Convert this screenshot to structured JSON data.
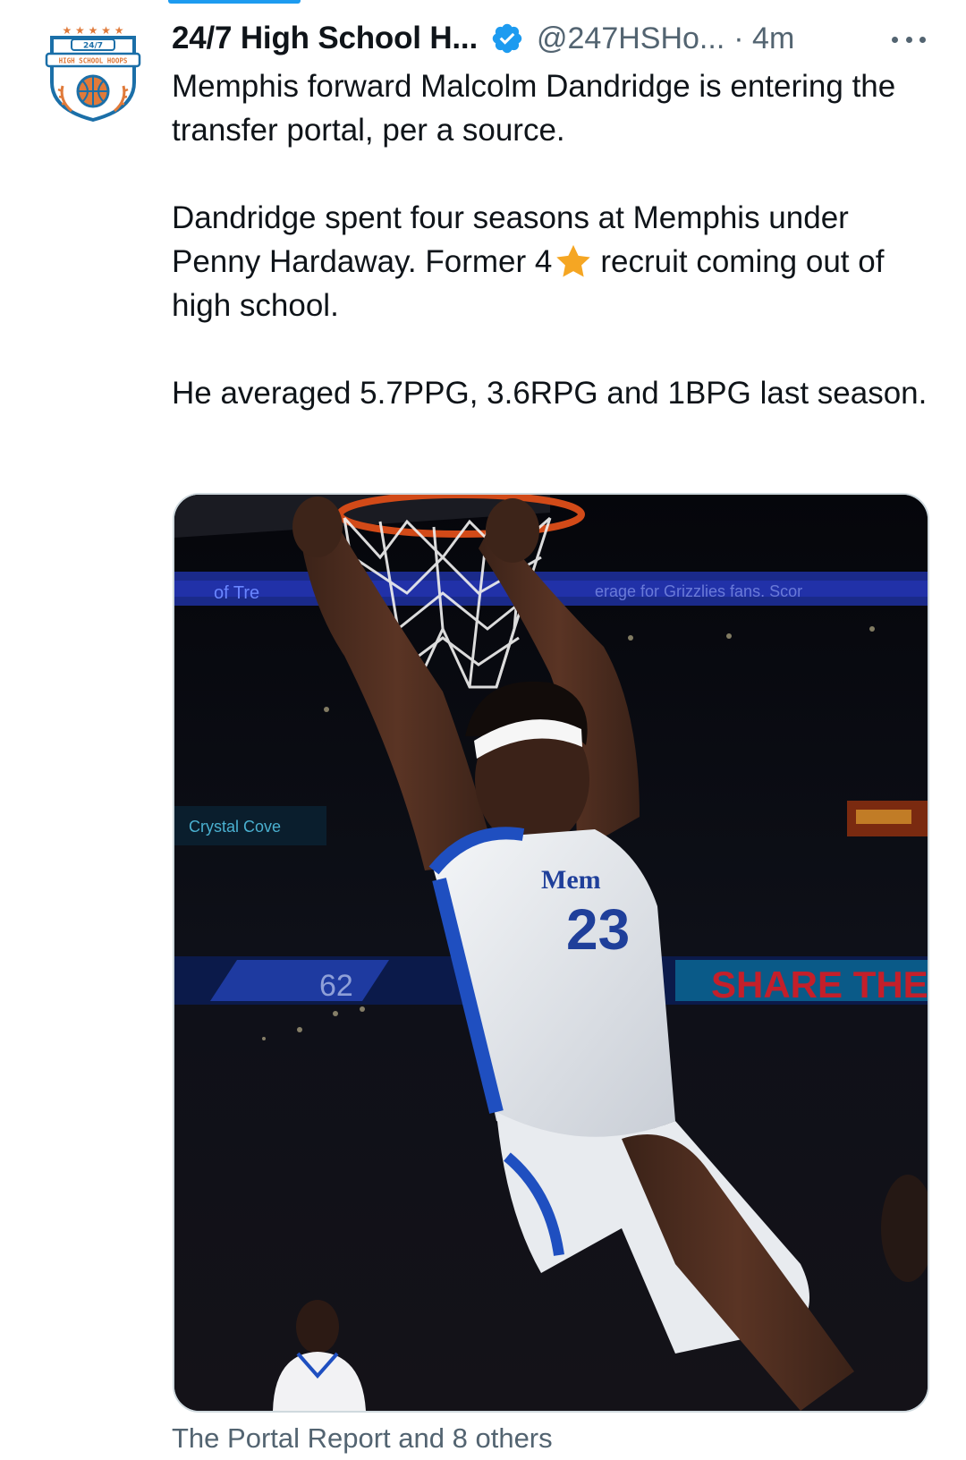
{
  "account": {
    "display_name": "24/7 High School H...",
    "handle": "@247HSHo...",
    "timestamp": "· 4m",
    "verified": true,
    "avatar": {
      "name": "247-high-school-hoops-logo",
      "badge_text": "24/7",
      "banner_text": "HIGH SCHOOL HOOPS",
      "stars": "★ ★ ★ ★ ★"
    }
  },
  "tweet": {
    "paragraph1": "Memphis forward Malcolm Dandridge is entering the transfer portal, per a source.",
    "paragraph2_before_star": "Dandridge spent four seasons at Memphis under Penny Hardaway. Former 4",
    "paragraph2_after_star": "recruit coming out of high school.",
    "paragraph3": "He averaged 5.7PPG, 3.6RPG and 1BPG last season."
  },
  "media": {
    "description_icon": "photo",
    "jersey_front": "Mem",
    "jersey_number": "23",
    "arena_banner_left": "of Tre",
    "arena_banner_right": "erage for Grizzlies fans. Scor",
    "arena_score": "62",
    "arena_share": "SHARE THE"
  },
  "tagged_people": "The Portal Report and 8 others",
  "colors": {
    "verified": "#1d9bf0",
    "star": "#f5a623",
    "secondary_text": "#536471",
    "logo_blue": "#1b6fa8",
    "logo_orange": "#e07a3a"
  }
}
